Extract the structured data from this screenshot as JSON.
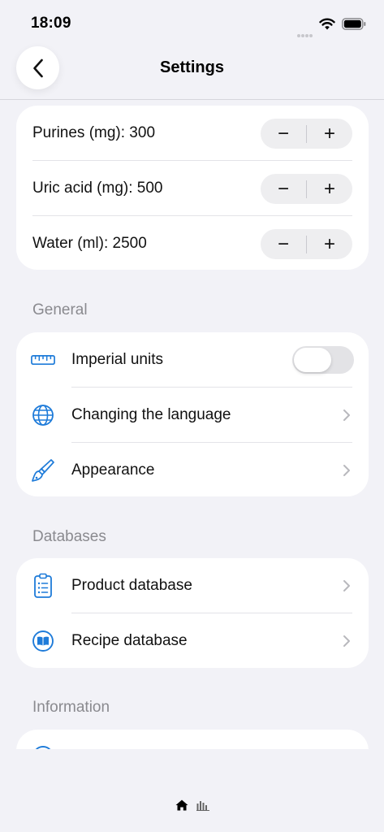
{
  "status_bar": {
    "time": "18:09"
  },
  "nav": {
    "title": "Settings"
  },
  "limits": [
    {
      "label": "Purines (mg): 300",
      "minus": "−",
      "plus": "+"
    },
    {
      "label": "Uric acid (mg): 500",
      "minus": "−",
      "plus": "+"
    },
    {
      "label": "Water (ml): 2500",
      "minus": "−",
      "plus": "+"
    }
  ],
  "general": {
    "header": "General",
    "items": [
      {
        "label": "Imperial units",
        "icon": "ruler-icon",
        "toggle_on": false
      },
      {
        "label": "Changing the language",
        "icon": "globe-icon"
      },
      {
        "label": "Appearance",
        "icon": "paintbrush-icon"
      }
    ]
  },
  "databases": {
    "header": "Databases",
    "items": [
      {
        "label": "Product database",
        "icon": "clipboard-list-icon"
      },
      {
        "label": "Recipe database",
        "icon": "book-icon"
      }
    ]
  },
  "information": {
    "header": "Information"
  },
  "tab_bar": {
    "items": [
      "home-icon",
      "chart-bar-icon"
    ]
  },
  "colors": {
    "accent": "#1e7bd9",
    "background": "#f2f2f7",
    "card": "#ffffff",
    "secondary_text": "#8a8a8f"
  }
}
